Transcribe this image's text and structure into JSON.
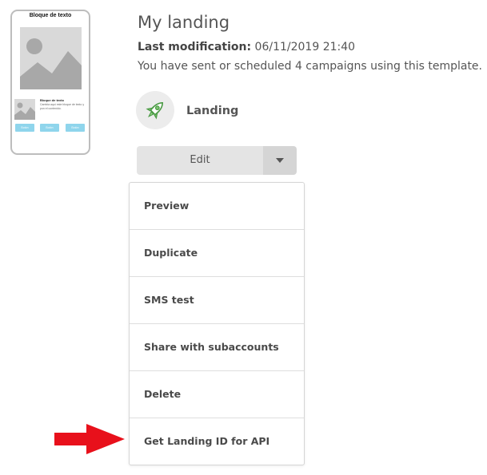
{
  "thumbnail": {
    "title": "Bloque de texto",
    "sub_title": "Bloque de texto",
    "sub_text": "Cambia aquí este bloque de texto y pon el contenido.",
    "buttons": [
      "Botón",
      "Botón",
      "Botón"
    ],
    "button_color": "#8fd5ec"
  },
  "header": {
    "title": "My landing",
    "last_mod_label": "Last modification:",
    "last_mod_value": "06/11/2019 21:40",
    "campaigns_text": "You have sent or scheduled 4 campaigns using this template."
  },
  "template_type": {
    "icon": "rocket-icon",
    "label": "Landing",
    "icon_color": "#5cb85c"
  },
  "actions": {
    "edit_label": "Edit",
    "caret_icon": "chevron-down-icon"
  },
  "menu": {
    "items": [
      {
        "label": "Preview"
      },
      {
        "label": "Duplicate"
      },
      {
        "label": "SMS test"
      },
      {
        "label": "Share with subaccounts"
      },
      {
        "label": "Delete"
      },
      {
        "label": "Get Landing ID for API"
      }
    ]
  },
  "annotation": {
    "icon": "red-arrow-icon",
    "color": "#e8101b"
  }
}
